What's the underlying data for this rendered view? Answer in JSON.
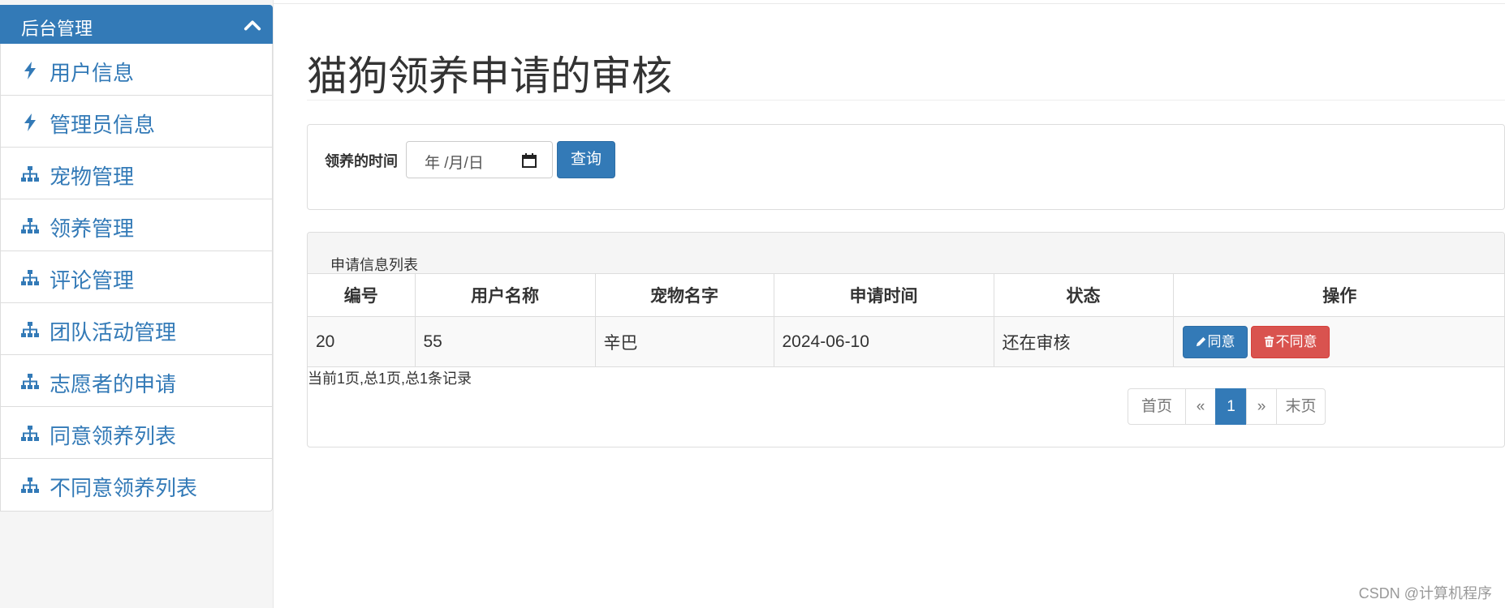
{
  "sidebar": {
    "header": "后台管理",
    "items": [
      {
        "label": "用户信息",
        "icon": "bolt-icon"
      },
      {
        "label": "管理员信息",
        "icon": "bolt-icon"
      },
      {
        "label": "宠物管理",
        "icon": "sitemap-icon"
      },
      {
        "label": "领养管理",
        "icon": "sitemap-icon"
      },
      {
        "label": "评论管理",
        "icon": "sitemap-icon"
      },
      {
        "label": "团队活动管理",
        "icon": "sitemap-icon"
      },
      {
        "label": "志愿者的申请",
        "icon": "sitemap-icon"
      },
      {
        "label": "同意领养列表",
        "icon": "sitemap-icon"
      },
      {
        "label": "不同意领养列表",
        "icon": "sitemap-icon"
      }
    ]
  },
  "main": {
    "title": "猫狗领养申请的审核",
    "search": {
      "label": "领养的时间",
      "date_placeholder": "年 /月/日",
      "button": "查询"
    },
    "list": {
      "caption": "申请信息列表",
      "columns": [
        "编号",
        "用户名称",
        "宠物名字",
        "申请时间",
        "状态",
        "操作"
      ],
      "rows": [
        {
          "id": "20",
          "user": "55",
          "pet": "辛巴",
          "date": "2024-06-10",
          "status": "还在审核",
          "approve": "同意",
          "reject": "不同意"
        }
      ],
      "summary": "当前1页,总1页,总1条记录",
      "pager": {
        "first": "首页",
        "prev": "«",
        "current": "1",
        "next": "»",
        "last": "末页"
      }
    }
  },
  "watermark": "CSDN @计算机程序",
  "colors": {
    "primary": "#337ab7",
    "danger": "#d9534f",
    "panel_bg": "#f5f5f5"
  }
}
